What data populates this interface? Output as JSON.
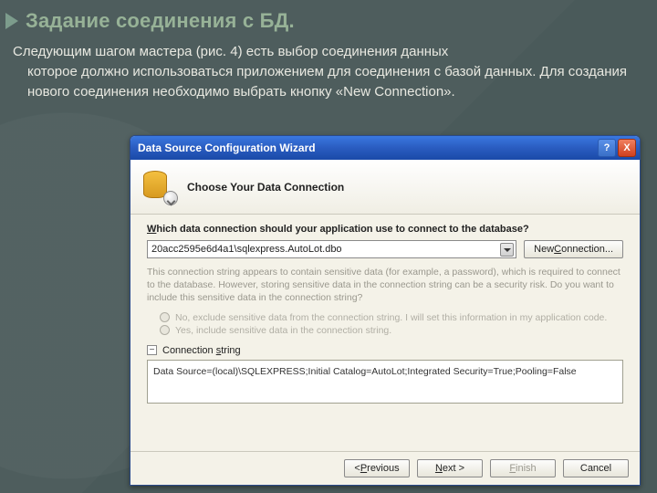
{
  "slide": {
    "title": "Задание соединения с БД.",
    "line1": "Следующим шагом мастера (рис. 4) есть выбор соединения данных",
    "line2": "которое должно использоваться приложением для соединения с базой данных. Для создания нового соединения необходимо выбрать кнопку «New Connection»."
  },
  "dialog": {
    "titlebar": "Data Source Configuration Wizard",
    "help": "?",
    "close": "X",
    "header": "Choose Your Data Connection",
    "question": "Which data connection should your application use to connect to the database?",
    "combo_value": "20acc2595e6d4a1\\sqlexpress.AutoLot.dbo",
    "new_connection": "New Connection...",
    "sensitive_text": "This connection string appears to contain sensitive data (for example, a password), which is required to connect to the database. However, storing sensitive data in the connection string can be a security risk. Do you want to include this sensitive data in the connection string?",
    "radio_no": "No, exclude sensitive data from the connection string. I will set this information in my application code.",
    "radio_yes": "Yes, include sensitive data in the connection string.",
    "expander_symbol": "−",
    "connstr_label": "Connection string",
    "connstr_value": "Data Source=(local)\\SQLEXPRESS;Initial Catalog=AutoLot;Integrated Security=True;Pooling=False",
    "buttons": {
      "previous": "< Previous",
      "next": "Next >",
      "finish": "Finish",
      "cancel": "Cancel"
    }
  }
}
